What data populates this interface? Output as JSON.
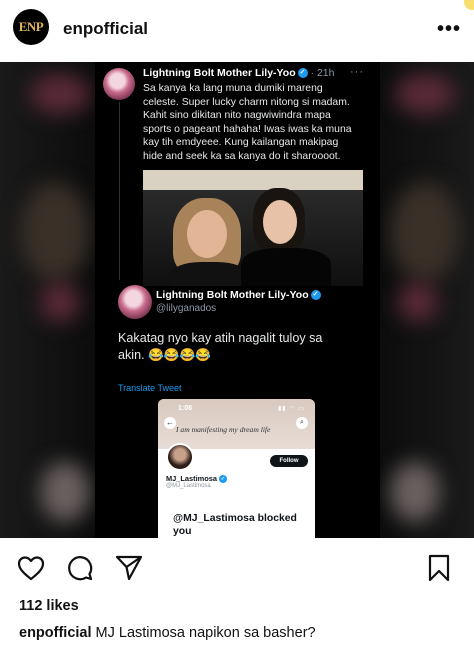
{
  "header": {
    "avatar_text": "ENP",
    "username": "enpofficial",
    "more_label": "•••"
  },
  "tweet1": {
    "name": "Lightning Bolt Mother Lily-Yoo",
    "time": "· 21h",
    "more": "···",
    "lines": [
      "Sa kanya ka lang muna dumiki mareng",
      "celeste. Super lucky charm nitong si madam.",
      "Kahit sino dikitan nito nagwiwindra mapa",
      "sports o pageant hahaha! Iwas iwas ka muna",
      "kay tih emdyeee. Kung kailangan makipag",
      "hide and seek ka sa kanya do it sharoooot."
    ]
  },
  "tweet2": {
    "name": "Lightning Bolt Mother Lily-Yoo",
    "handle": "@lilyganados",
    "lines": [
      "Kakatag nyo kay atih nagalit tuloy sa",
      "akin. 😂😂😂😂"
    ],
    "translate": "Translate Tweet"
  },
  "phone": {
    "time": "1:08",
    "status": "▮▮ ◠ ▭",
    "banner": "I am manifesting my dream life",
    "follow": "Follow",
    "name": "MJ_Lastimosa",
    "handle": "@MJ_Lastimosa",
    "blocked": "@MJ_Lastimosa blocked you"
  },
  "post": {
    "likes": "112 likes",
    "caption_user": "enpofficial",
    "caption_text": "MJ Lastimosa napikon sa basher?"
  }
}
